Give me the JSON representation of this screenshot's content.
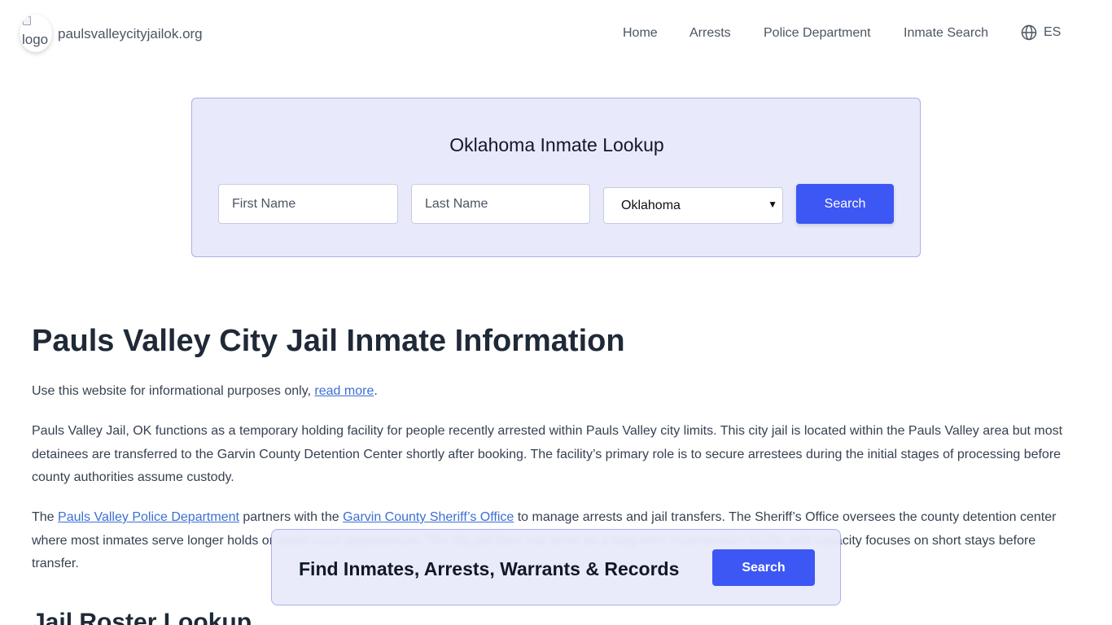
{
  "header": {
    "logo_alt": "logo",
    "site_name": "paulsvalleycityjailok.org",
    "nav": {
      "home": "Home",
      "arrests": "Arrests",
      "police": "Police Department",
      "inmate_search": "Inmate Search"
    },
    "language": "ES"
  },
  "search": {
    "title": "Oklahoma Inmate Lookup",
    "first_placeholder": "First Name",
    "last_placeholder": "Last Name",
    "state_value": "Oklahoma",
    "button": "Search"
  },
  "content": {
    "title": "Pauls Valley City Jail Inmate Information",
    "p1_text": "Use this website for informational purposes only, ",
    "p1_link": "read more",
    "p1_end": ".",
    "p2": "Pauls Valley Jail, OK functions as a temporary holding facility for people recently arrested within Pauls Valley city limits. This city jail is located within the Pauls Valley area but most detainees are transferred to the Garvin County Detention Center shortly after booking. The facility’s primary role is to secure arrestees during the initial stages of processing before county authorities assume custody.",
    "p3_a": "The ",
    "p3_link1": "Pauls Valley Police Department",
    "p3_b": " partners with the ",
    "p3_link2": "Garvin County Sheriff’s Office",
    "p3_c": " to manage arrests and jail transfers. The Sheriff’s Office oversees the county detention center where most inmates serve longer holds or await court appearances. The city jail does not serve as a long-term incarceration facility and capacity focuses on short stays before transfer.",
    "section_title": "Jail Roster Lookup"
  },
  "banner": {
    "text": "Find Inmates, Arrests, Warrants & Records",
    "button": "Search"
  },
  "colors": {
    "accent": "#3d57f5",
    "card_bg": "#e8eafb",
    "link": "#3b6fd4"
  }
}
